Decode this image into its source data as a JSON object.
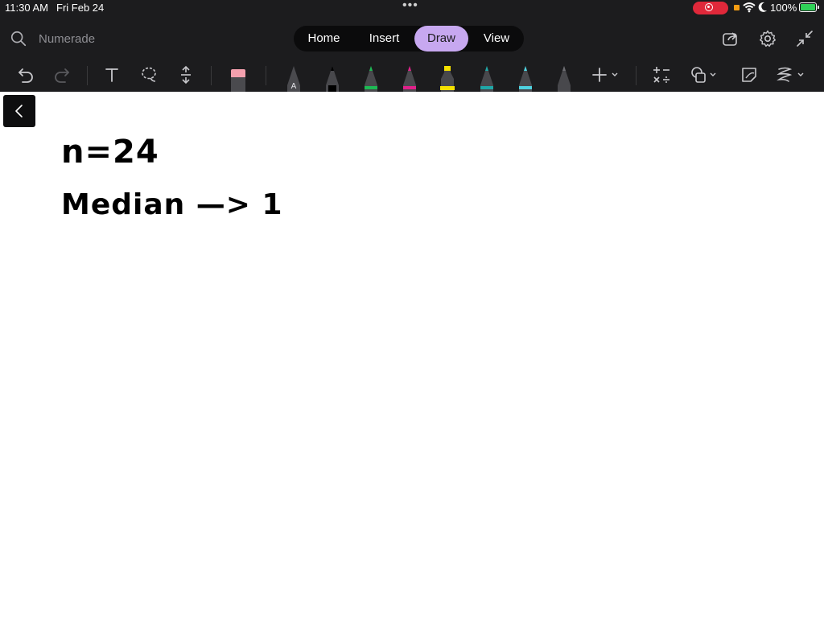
{
  "status": {
    "time": "11:30 AM",
    "date": "Fri Feb 24",
    "battery": "100%"
  },
  "search": {
    "label": "Numerade"
  },
  "tabs": [
    {
      "label": "Home"
    },
    {
      "label": "Insert"
    },
    {
      "label": "Draw",
      "active": true
    },
    {
      "label": "View"
    }
  ],
  "colors": {
    "toolbar_bg": "#1c1c1e",
    "active_tab": "#c7a8f0",
    "record": "#e0283a",
    "battery": "#30d158",
    "pens": [
      "#8e8e93",
      "#000000",
      "#1db954",
      "#e0208a",
      "#f5e100",
      "#1fa7a7",
      "#4fd2e0",
      "#6e6e73"
    ]
  },
  "tools": [
    "undo-icon",
    "redo-icon",
    "text-icon",
    "lasso-icon",
    "space-icon",
    "eraser-icon",
    "pen-a",
    "pen-black",
    "pen-green",
    "pen-pink",
    "highlighter-yellow",
    "pen-teal",
    "pen-cyan",
    "pen-gray",
    "add-icon",
    "math-icon",
    "shapes-icon",
    "sticky-note-icon",
    "ink-to-shape-icon"
  ],
  "canvas": {
    "line1": "n=24",
    "line2": "Median —> 1"
  }
}
